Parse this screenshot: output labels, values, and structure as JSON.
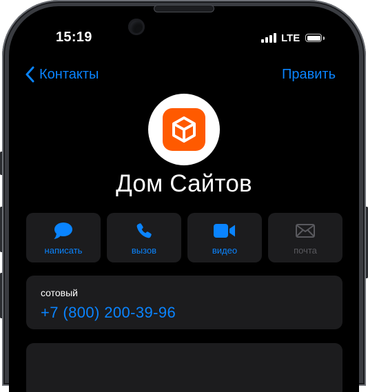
{
  "status": {
    "time": "15:19",
    "network": "LTE"
  },
  "nav": {
    "back_label": "Контакты",
    "edit_label": "Править"
  },
  "contact": {
    "name": "Дом Сайтов"
  },
  "actions": {
    "message": "написать",
    "call": "вызов",
    "video": "видео",
    "mail": "почта"
  },
  "phone": {
    "label": "сотовый",
    "number": "+7 (800) 200-39-96"
  },
  "colors": {
    "accent": "#0a84ff",
    "background": "#000000",
    "card": "#1c1c1e",
    "avatar_brand": "#ff5a00",
    "disabled": "#59595e"
  },
  "icons": {
    "back": "chevron-left-icon",
    "message": "speech-bubble-icon",
    "call": "phone-icon",
    "video": "video-camera-icon",
    "mail": "envelope-icon",
    "avatar": "cube-logo-icon"
  }
}
